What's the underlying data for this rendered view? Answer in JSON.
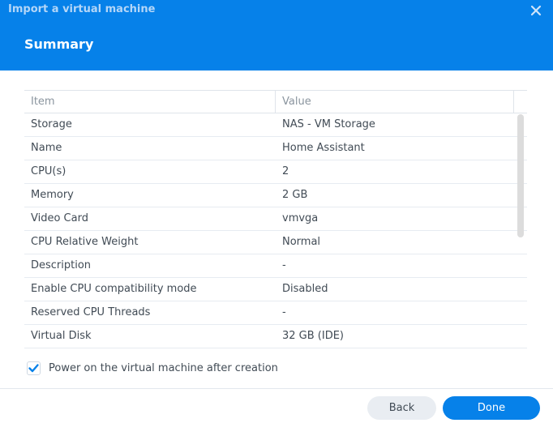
{
  "window": {
    "title": "Import a virtual machine",
    "close_icon": "close-icon"
  },
  "step": {
    "title": "Summary"
  },
  "table": {
    "columns": [
      "Item",
      "Value"
    ],
    "rows": [
      {
        "item": "Storage",
        "value": "NAS - VM Storage"
      },
      {
        "item": "Name",
        "value": "Home Assistant"
      },
      {
        "item": "CPU(s)",
        "value": "2"
      },
      {
        "item": "Memory",
        "value": "2 GB"
      },
      {
        "item": "Video Card",
        "value": "vmvga"
      },
      {
        "item": "CPU Relative Weight",
        "value": "Normal"
      },
      {
        "item": "Description",
        "value": "-"
      },
      {
        "item": "Enable CPU compatibility mode",
        "value": "Disabled"
      },
      {
        "item": "Reserved CPU Threads",
        "value": "-"
      },
      {
        "item": "Virtual Disk",
        "value": "32 GB (IDE)"
      }
    ]
  },
  "options": {
    "power_on_label": "Power on the virtual machine after creation",
    "power_on_checked": true
  },
  "footer": {
    "back_label": "Back",
    "done_label": "Done"
  },
  "colors": {
    "header": "#0681e9",
    "primary_button": "#0681e9",
    "secondary_button": "#e9edf2",
    "checkmark": "#0681e9"
  }
}
